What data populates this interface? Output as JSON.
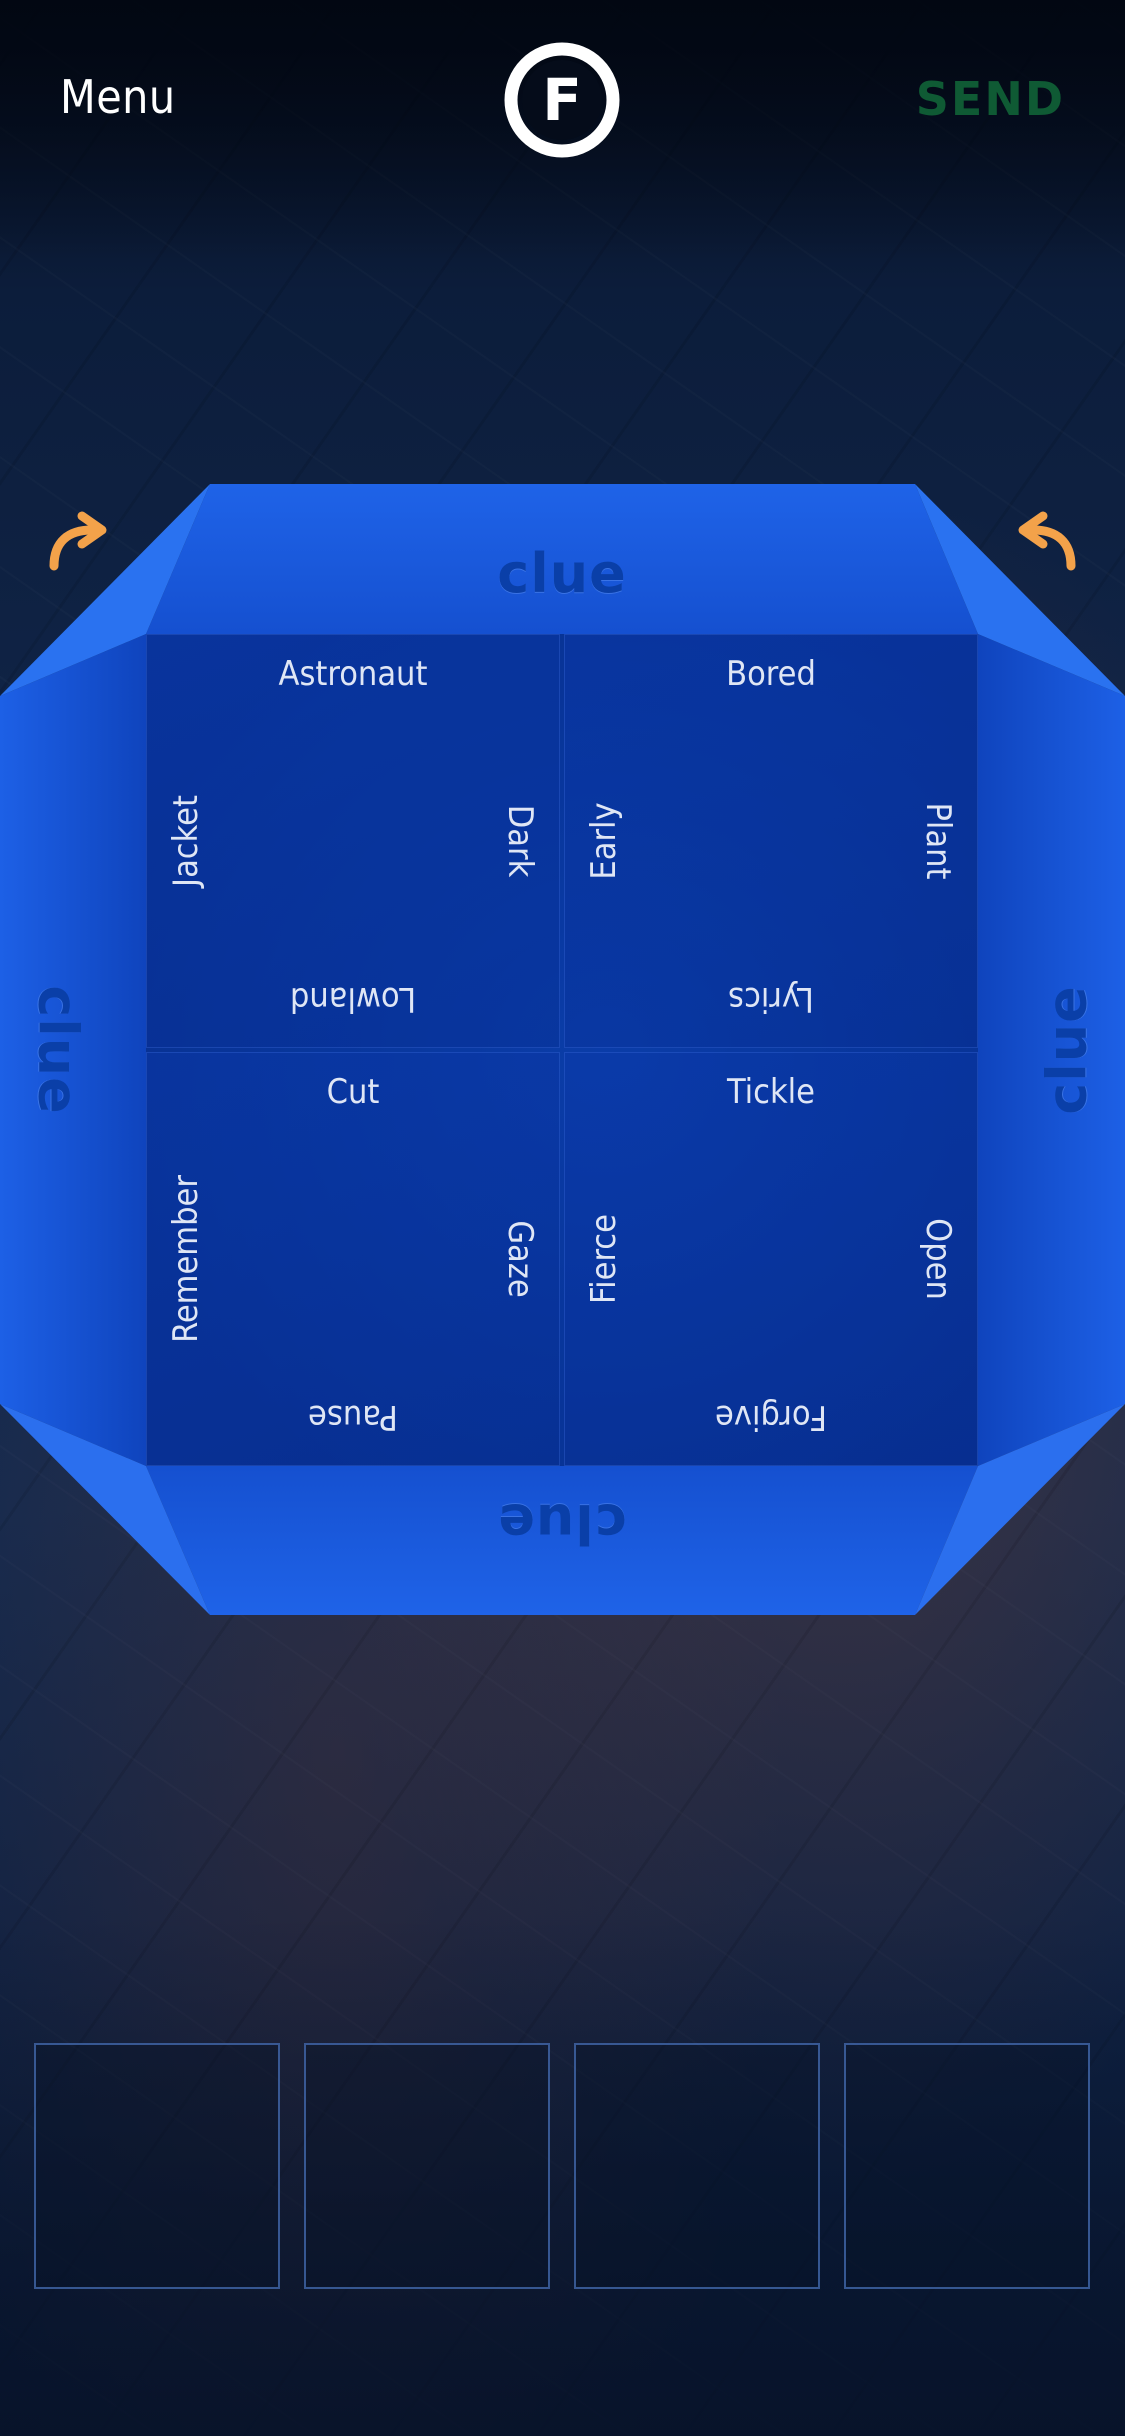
{
  "header": {
    "menu_label": "Menu",
    "logo_letter": "F",
    "send_label": "SEND",
    "send_color": "#0f5a34"
  },
  "controls": {
    "rotate_left_icon": "curved-arrow-right-icon",
    "rotate_right_icon": "curved-arrow-left-icon",
    "arrow_color": "#f3a24a"
  },
  "board": {
    "clues": {
      "top": "clue",
      "right": "clue",
      "bottom": "clue",
      "left": "clue"
    },
    "cards": [
      {
        "top": "Astronaut",
        "right": "Dark",
        "bottom": "Lowland",
        "left": "Jacket"
      },
      {
        "top": "Bored",
        "right": "Plant",
        "bottom": "Lyrics",
        "left": "Early"
      },
      {
        "top": "Cut",
        "right": "Gaze",
        "bottom": "Pause",
        "left": "Remember"
      },
      {
        "top": "Tickle",
        "right": "Open",
        "bottom": "Forgive",
        "left": "Fierce"
      }
    ],
    "frame_color": "#1a5ce0"
  },
  "tray": {
    "slot_count": 4
  }
}
